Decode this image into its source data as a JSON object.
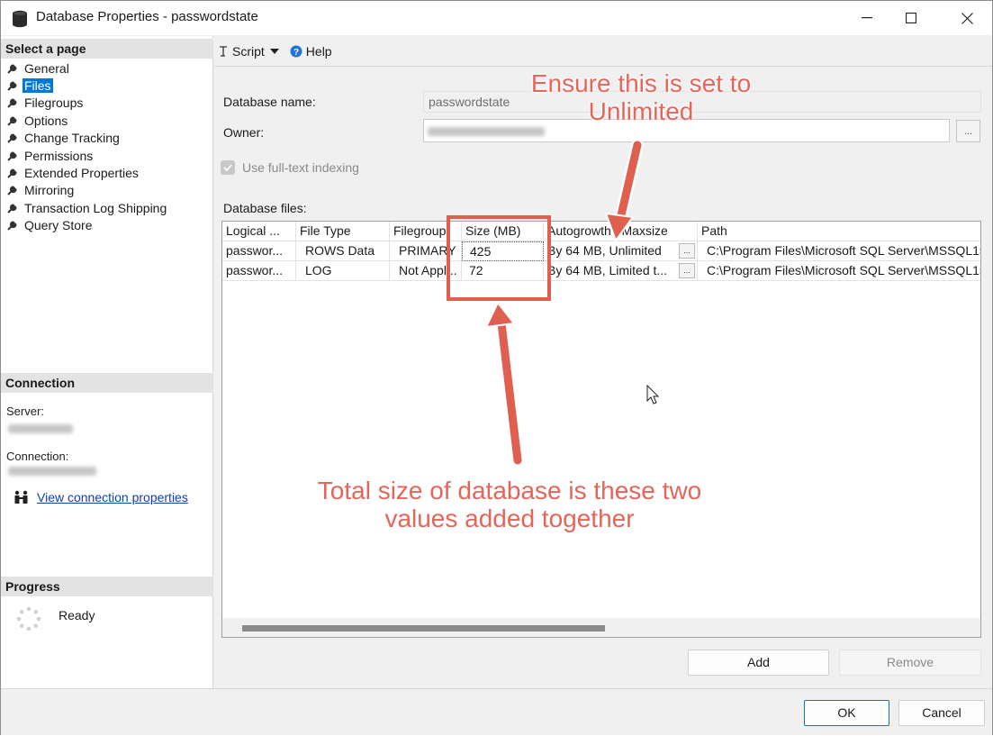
{
  "window": {
    "title": "Database Properties - passwordstate",
    "minimize_glyph": "—",
    "maximize_glyph": "☐",
    "close_glyph": "✕"
  },
  "sidebar": {
    "select_page_heading": "Select a page",
    "items": [
      {
        "label": "General"
      },
      {
        "label": "Files",
        "selected": true
      },
      {
        "label": "Filegroups"
      },
      {
        "label": "Options"
      },
      {
        "label": "Change Tracking"
      },
      {
        "label": "Permissions"
      },
      {
        "label": "Extended Properties"
      },
      {
        "label": "Mirroring"
      },
      {
        "label": "Transaction Log Shipping"
      },
      {
        "label": "Query Store"
      }
    ],
    "connection_heading": "Connection",
    "server_label": "Server:",
    "connection_label": "Connection:",
    "view_connection_link": "View connection properties",
    "progress_heading": "Progress",
    "progress_status": "Ready"
  },
  "toolbar": {
    "script_label": "Script",
    "help_label": "Help"
  },
  "form": {
    "database_name_label": "Database name:",
    "database_name_value": "passwordstate",
    "owner_label": "Owner:",
    "owner_browse_label": "...",
    "fulltext_label": "Use full-text indexing",
    "database_files_label": "Database files:"
  },
  "files_grid": {
    "columns": [
      "Logical ...",
      "File Type",
      "Filegroup",
      "Size (MB)",
      "Autogrowth / Maxsize",
      "Path"
    ],
    "rows": [
      [
        "passwor...",
        "ROWS Data",
        "PRIMARY",
        "425",
        "By 64 MB, Unlimited",
        "C:\\Program Files\\Microsoft SQL Server\\MSSQL15."
      ],
      [
        "passwor...",
        "LOG",
        "Not Appl...",
        "72",
        "By 64 MB, Limited t...",
        "C:\\Program Files\\Microsoft SQL Server\\MSSQL15."
      ]
    ],
    "ellipsis_label": "..."
  },
  "buttons": {
    "add": "Add",
    "remove": "Remove",
    "ok": "OK",
    "cancel": "Cancel"
  },
  "annotations": {
    "top_note_line1": "Ensure this is set to",
    "top_note_line2": "Unlimited",
    "bottom_note_line1": "Total size of database is these two",
    "bottom_note_line2": "values added together",
    "color": "#e06050"
  },
  "colors": {
    "selection": "#0078d7",
    "link": "#0645ad"
  }
}
